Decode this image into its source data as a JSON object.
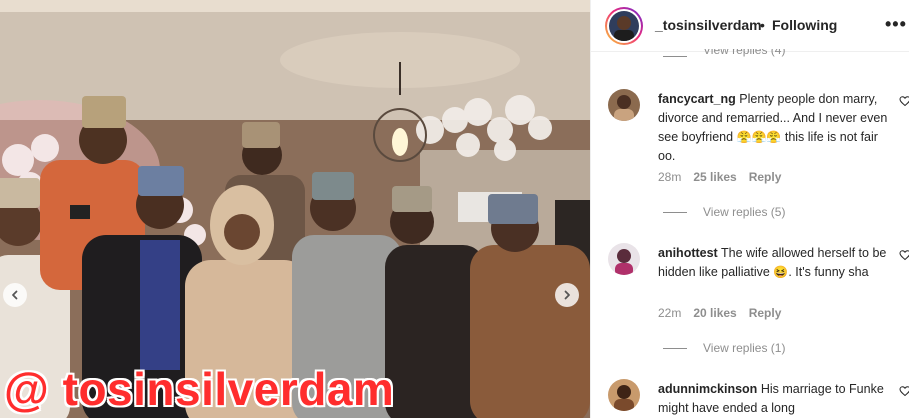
{
  "post": {
    "watermark_text": "@ tosinsilverdam",
    "carousel": {
      "prev_icon": "chevron-left-icon",
      "next_icon": "chevron-right-icon"
    }
  },
  "header": {
    "username": "_tosinsilverdam",
    "separator": "•",
    "follow_status": "Following",
    "more_icon": "more-horizontal-icon",
    "more_label": "•••"
  },
  "top_view_replies": {
    "label": "View replies (4)"
  },
  "comments": [
    {
      "username": "fancycart_ng",
      "text": "Plenty people don marry, divorce and remarried... And I never even see boyfriend",
      "emojis": "😤😤😤",
      "text_after": "this life is not fair oo.",
      "time": "28m",
      "likes": "25 likes",
      "reply_label": "Reply",
      "view_replies": "View replies (5)"
    },
    {
      "username": "anihottest",
      "text": "The wife allowed herself to be hidden like palliative",
      "emojis": "😆",
      "text_after": ". It's funny sha",
      "time": "22m",
      "likes": "20 likes",
      "reply_label": "Reply",
      "view_replies": "View replies (1)"
    },
    {
      "username": "adunnimckinson",
      "text": "His marriage to Funke might have ended a long",
      "emojis": "",
      "text_after": ""
    }
  ],
  "colors": {
    "watermark": "#ff2d2d",
    "link_grey": "#8e8e8e",
    "text": "#262626",
    "story_ring_start": "#f9ce34",
    "story_ring_end": "#6228d7"
  }
}
